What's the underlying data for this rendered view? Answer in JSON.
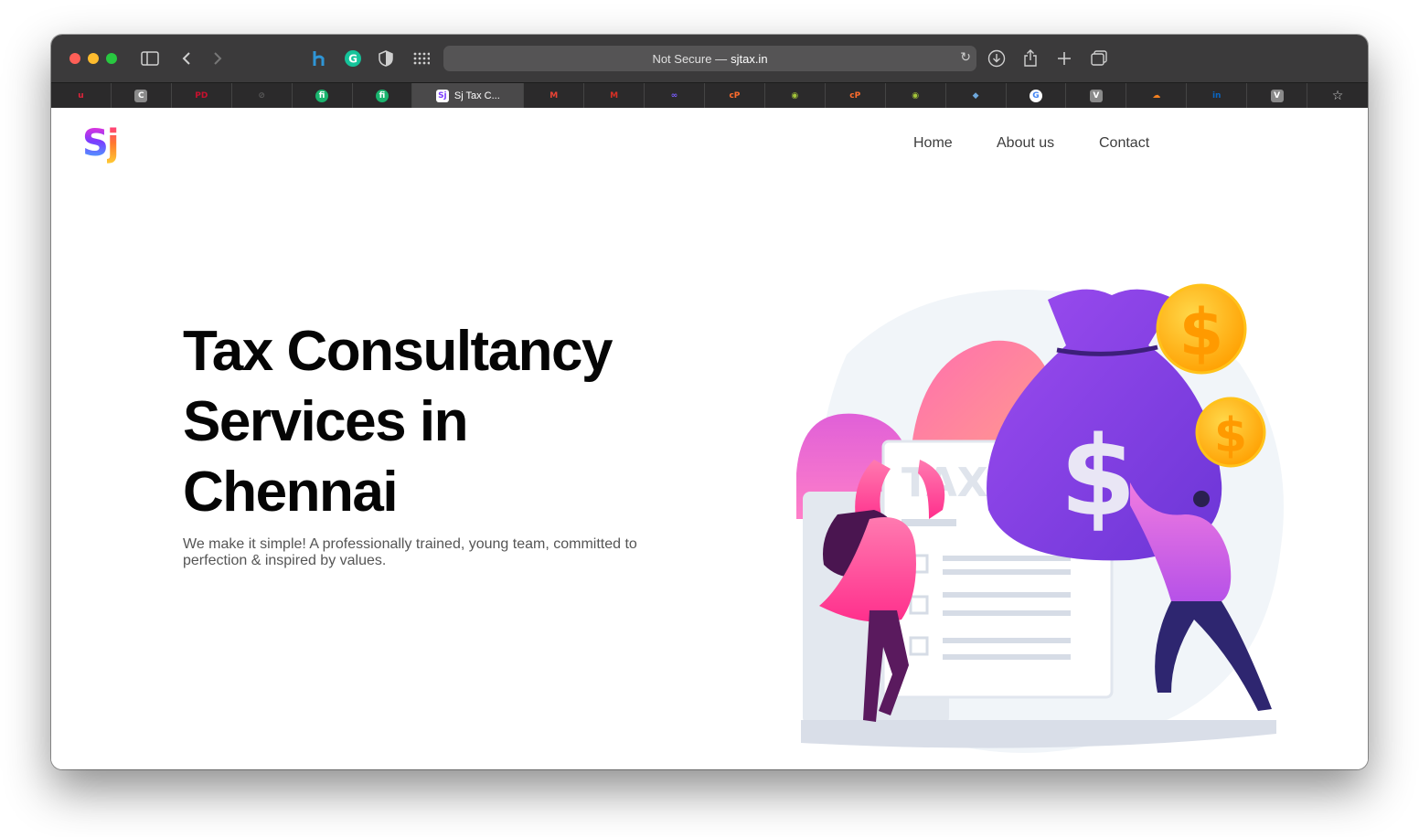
{
  "browser": {
    "url_security": "Not Secure —",
    "url_domain": "sjtax.in",
    "active_tab_title": "Sj Tax C...",
    "tabs": [
      {
        "icon": "u-icon",
        "glyph": "u",
        "color": "#e0233b"
      },
      {
        "icon": "c-icon",
        "glyph": "C",
        "color": "#8a8a8a"
      },
      {
        "icon": "pd-icon",
        "glyph": "PD",
        "color": "#c8102e"
      },
      {
        "icon": "compass-icon",
        "glyph": "⊘",
        "color": "#5a5a5a"
      },
      {
        "icon": "fi-icon",
        "glyph": "fi",
        "color": "#1ab46e"
      },
      {
        "icon": "fi-icon",
        "glyph": "fi",
        "color": "#1ab46e"
      },
      {
        "icon": "sj-icon",
        "glyph": "Sj",
        "color": "#ffffff"
      },
      {
        "icon": "gmail-icon",
        "glyph": "M",
        "color": "#ea4335"
      },
      {
        "icon": "gmail-red-icon",
        "glyph": "M",
        "color": "#d93025"
      },
      {
        "icon": "infinity-icon",
        "glyph": "∞",
        "color": "#7a5cff"
      },
      {
        "icon": "cpanel-icon",
        "glyph": "cP",
        "color": "#ff6c2c"
      },
      {
        "icon": "owl-icon",
        "glyph": "◉",
        "color": "#a4c639"
      },
      {
        "icon": "cpanel-icon",
        "glyph": "cP",
        "color": "#ff6c2c"
      },
      {
        "icon": "owl-icon",
        "glyph": "◉",
        "color": "#a4c639"
      },
      {
        "icon": "cube-icon",
        "glyph": "◆",
        "color": "#6fa8dc"
      },
      {
        "icon": "google-icon",
        "glyph": "G",
        "color": "#4285f4"
      },
      {
        "icon": "v-icon",
        "glyph": "V",
        "color": "#8a8a8a"
      },
      {
        "icon": "cloudflare-icon",
        "glyph": "☁",
        "color": "#f38020"
      },
      {
        "icon": "linkedin-icon",
        "glyph": "in",
        "color": "#0a66c2"
      },
      {
        "icon": "v-icon",
        "glyph": "V",
        "color": "#8a8a8a"
      }
    ]
  },
  "site": {
    "logo_s": "S",
    "logo_j": "j",
    "nav": {
      "home": "Home",
      "about": "About us",
      "contact": "Contact"
    },
    "hero": {
      "title_line1": "Tax Consultancy",
      "title_line2": "Services in",
      "title_line3": "Chennai",
      "subtitle": "We make it simple! A professionally trained, young team, committed to perfection & inspired by values."
    },
    "illustration": {
      "paper_label": "TAX",
      "bag_symbol": "$",
      "coin_symbol": "$"
    }
  },
  "colors": {
    "accent_purple": "#8b5cf6",
    "accent_pink": "#ff5fa8",
    "coin_gold": "#ffb400"
  }
}
